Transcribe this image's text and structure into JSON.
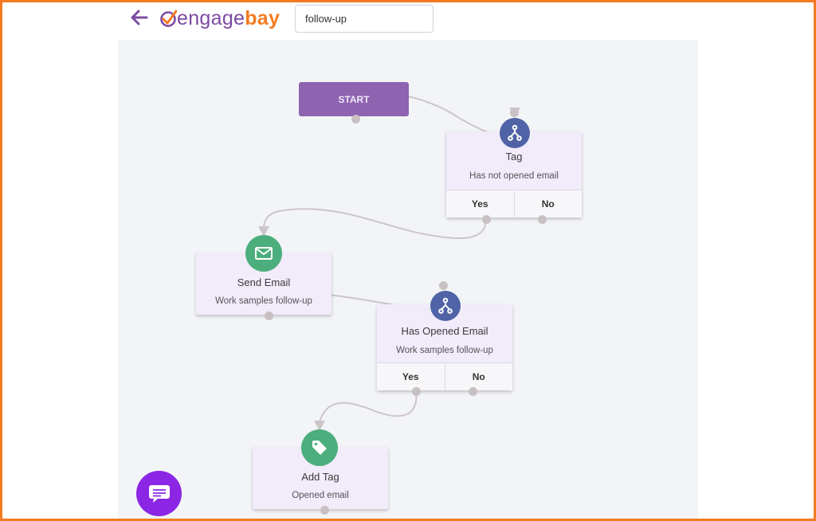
{
  "header": {
    "logo_part1": "engage",
    "logo_part2": "bay",
    "search_value": "follow-up",
    "back_icon": "arrow-left-icon"
  },
  "flow": {
    "start_label": "START",
    "nodes": [
      {
        "id": "tag",
        "icon": "branch-icon",
        "title": "Tag",
        "subtitle": "Has not opened email",
        "yes": "Yes",
        "no": "No"
      },
      {
        "id": "send-email",
        "icon": "envelope-icon",
        "title": "Send Email",
        "subtitle": "Work samples follow-up"
      },
      {
        "id": "has-opened-email",
        "icon": "branch-icon",
        "title": "Has Opened Email",
        "subtitle": "Work samples follow-up",
        "yes": "Yes",
        "no": "No"
      },
      {
        "id": "add-tag",
        "icon": "tag-icon",
        "title": "Add Tag",
        "subtitle": "Opened email"
      }
    ]
  },
  "colors": {
    "frame_border": "#f47b20",
    "brand_purple": "#7c4aa3",
    "brand_orange": "#f47b20",
    "start_node": "#8e63b0",
    "condition_icon": "#4f63a6",
    "action_icon": "#4cae7c",
    "chat_button": "#8a26e4"
  },
  "chat_icon": "chat-icon"
}
